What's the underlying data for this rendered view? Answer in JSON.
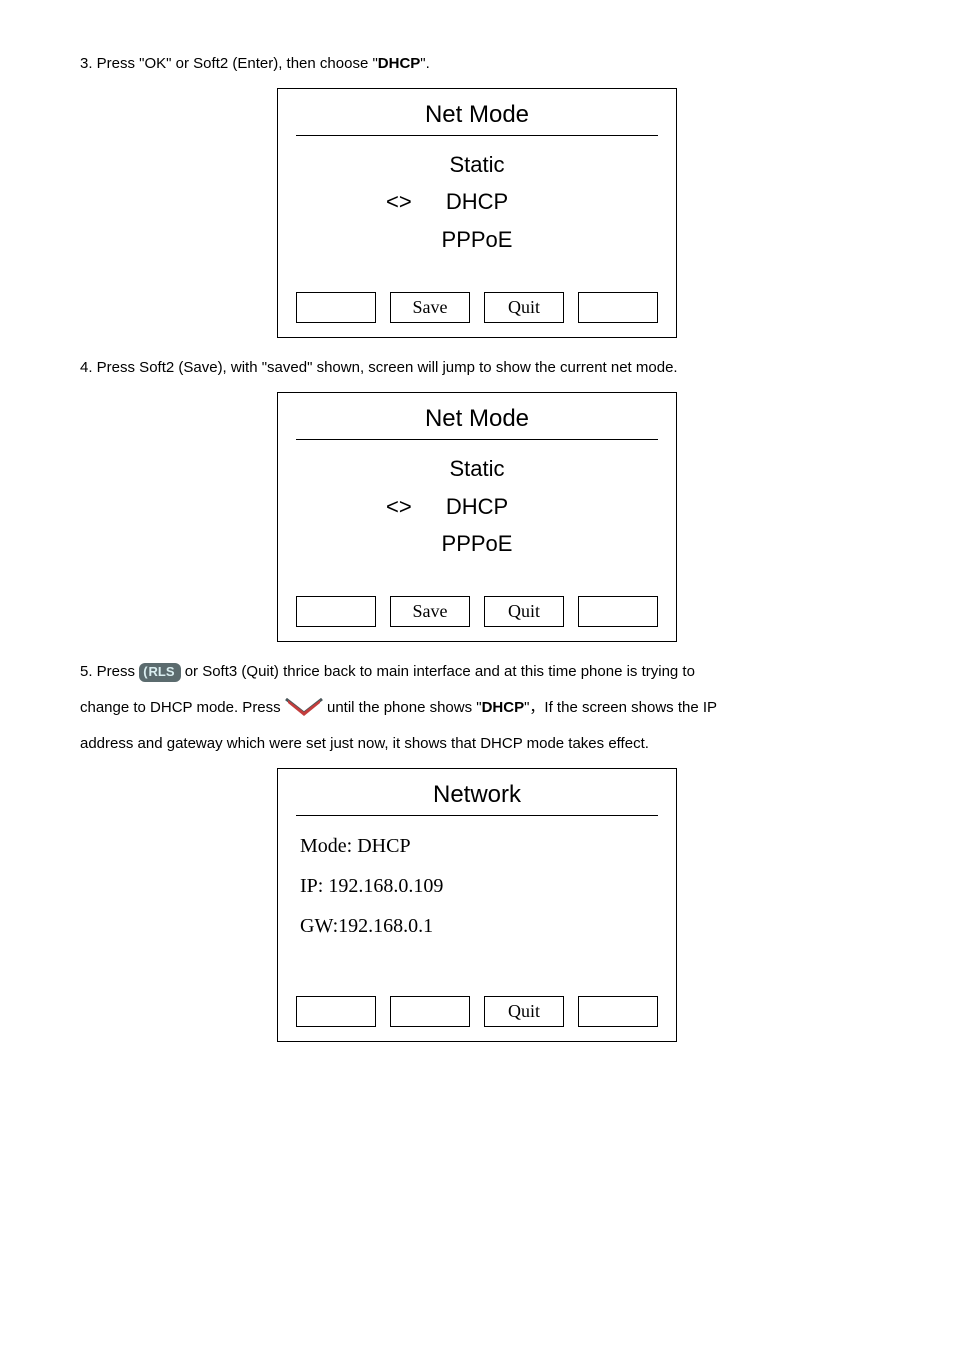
{
  "step3": {
    "text_before": "3. Press \"OK\" or Soft2 (Enter), then choose \"",
    "bold": "DHCP",
    "text_after": "\"."
  },
  "screen1": {
    "title": "Net Mode",
    "items": [
      "Static",
      "DHCP",
      "PPPoE"
    ],
    "marker": "<>",
    "softkeys": [
      "",
      "Save",
      "Quit",
      ""
    ]
  },
  "step4": "4. Press Soft2 (Save), with \"saved\" shown, screen will jump to show the current net mode.",
  "screen2": {
    "title": "Net Mode",
    "items": [
      "Static",
      "DHCP",
      "PPPoE"
    ],
    "marker": "<>",
    "softkeys": [
      "",
      "Save",
      "Quit",
      ""
    ]
  },
  "step5": {
    "p1_before": "5. Press ",
    "rls_label": "RLS",
    "p1_after": "or Soft3 (Quit) thrice back to main interface and at this time phone is trying to",
    "p2_before": "change to DHCP mode. Press ",
    "p2_mid1": "until the phone shows \"",
    "p2_bold": "DHCP",
    "p2_mid2": "\"，If the screen shows the IP",
    "p3": "address and gateway which were set just now, it shows that DHCP mode takes effect."
  },
  "screen3": {
    "title": "Network",
    "lines": [
      "Mode: DHCP",
      "IP: 192.168.0.109",
      "GW:192.168.0.1"
    ],
    "softkeys": [
      "",
      "",
      "Quit",
      ""
    ]
  }
}
